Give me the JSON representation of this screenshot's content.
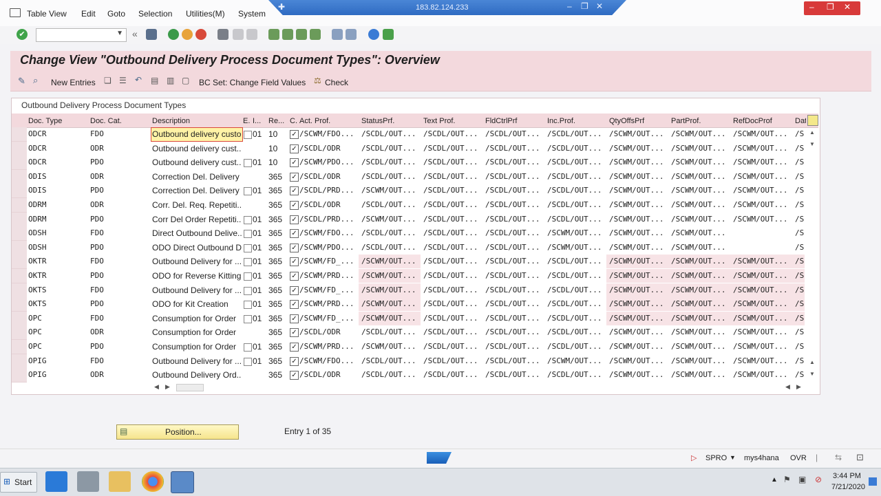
{
  "window": {
    "remote_host": "183.82.124.233"
  },
  "menu": [
    "Table View",
    "Edit",
    "Goto",
    "Selection",
    "Utilities(M)",
    "System"
  ],
  "page_title": "Change View \"Outbound Delivery Process Document Types\": Overview",
  "app_toolbar": {
    "new_entries": "New Entries",
    "bc_set": "BC Set: Change Field Values",
    "check": "Check"
  },
  "grid": {
    "title": "Outbound Delivery Process Document Types",
    "columns": [
      "Doc. Type",
      "Doc. Cat.",
      "Description",
      "E.",
      "I...",
      "Re...",
      "C.",
      "Act. Prof.",
      "StatusPrf.",
      "Text Prof.",
      "FldCtrlPrf",
      "Inc.Prof.",
      "QtyOffsPrf",
      "PartProf.",
      "RefDocProf",
      "Dat"
    ],
    "rows": [
      {
        "type": "ODCR",
        "cat": "FDO",
        "desc": "Outbound delivery custor",
        "e": true,
        "i": "01",
        "re": "10",
        "act": "/SCWM/FDO...",
        "status": "/SCDL/OUT...",
        "text": "/SCDL/OUT...",
        "fld": "/SCDL/OUT...",
        "inc": "/SCDL/OUT...",
        "qty": "/SCWM/OUT...",
        "part": "/SCWM/OUT...",
        "ref": "/SCWM/OUT...",
        "dat": "/S"
      },
      {
        "type": "ODCR",
        "cat": "ODR",
        "desc": "Outbound delivery cust...",
        "e": false,
        "i": "",
        "re": "10",
        "act": "/SCDL/ODR",
        "status": "/SCDL/OUT...",
        "text": "/SCDL/OUT...",
        "fld": "/SCDL/OUT...",
        "inc": "/SCDL/OUT...",
        "qty": "/SCWM/OUT...",
        "part": "/SCWM/OUT...",
        "ref": "/SCWM/OUT...",
        "dat": "/S"
      },
      {
        "type": "ODCR",
        "cat": "PDO",
        "desc": "Outbound delivery cust...",
        "e": true,
        "i": "01",
        "re": "10",
        "act": "/SCWM/PDO...",
        "status": "/SCDL/OUT...",
        "text": "/SCDL/OUT...",
        "fld": "/SCDL/OUT...",
        "inc": "/SCDL/OUT...",
        "qty": "/SCWM/OUT...",
        "part": "/SCWM/OUT...",
        "ref": "/SCWM/OUT...",
        "dat": "/S"
      },
      {
        "type": "ODIS",
        "cat": "ODR",
        "desc": "Correction Del. Delivery",
        "e": false,
        "i": "",
        "re": "365",
        "act": "/SCDL/ODR",
        "status": "/SCDL/OUT...",
        "text": "/SCDL/OUT...",
        "fld": "/SCDL/OUT...",
        "inc": "/SCDL/OUT...",
        "qty": "/SCWM/OUT...",
        "part": "/SCWM/OUT...",
        "ref": "/SCWM/OUT...",
        "dat": "/S"
      },
      {
        "type": "ODIS",
        "cat": "PDO",
        "desc": "Correction Del. Delivery",
        "e": true,
        "i": "01",
        "re": "365",
        "act": "/SCDL/PRD...",
        "status": "/SCWM/OUT...",
        "text": "/SCDL/OUT...",
        "fld": "/SCDL/OUT...",
        "inc": "/SCDL/OUT...",
        "qty": "/SCWM/OUT...",
        "part": "/SCWM/OUT...",
        "ref": "/SCWM/OUT...",
        "dat": "/S"
      },
      {
        "type": "ODRM",
        "cat": "ODR",
        "desc": "Corr. Del. Req. Repetiti...",
        "e": false,
        "i": "",
        "re": "365",
        "act": "/SCDL/ODR",
        "status": "/SCDL/OUT...",
        "text": "/SCDL/OUT...",
        "fld": "/SCDL/OUT...",
        "inc": "/SCDL/OUT...",
        "qty": "/SCWM/OUT...",
        "part": "/SCWM/OUT...",
        "ref": "/SCWM/OUT...",
        "dat": "/S"
      },
      {
        "type": "ODRM",
        "cat": "PDO",
        "desc": "Corr Del Order Repetiti...",
        "e": true,
        "i": "01",
        "re": "365",
        "act": "/SCDL/PRD...",
        "status": "/SCWM/OUT...",
        "text": "/SCDL/OUT...",
        "fld": "/SCDL/OUT...",
        "inc": "/SCDL/OUT...",
        "qty": "/SCWM/OUT...",
        "part": "/SCWM/OUT...",
        "ref": "/SCWM/OUT...",
        "dat": "/S"
      },
      {
        "type": "ODSH",
        "cat": "FDO",
        "desc": "Direct Outbound Delive...",
        "e": true,
        "i": "01",
        "re": "365",
        "act": "/SCWM/FDO...",
        "status": "/SCDL/OUT...",
        "text": "/SCDL/OUT...",
        "fld": "/SCDL/OUT...",
        "inc": "/SCWM/OUT...",
        "qty": "/SCWM/OUT...",
        "part": "/SCWM/OUT...",
        "ref": "",
        "dat": "/S"
      },
      {
        "type": "ODSH",
        "cat": "PDO",
        "desc": "ODO Direct Outbound D...",
        "e": true,
        "i": "01",
        "re": "365",
        "act": "/SCWM/PDO...",
        "status": "/SCDL/OUT...",
        "text": "/SCDL/OUT...",
        "fld": "/SCDL/OUT...",
        "inc": "/SCWM/OUT...",
        "qty": "/SCWM/OUT...",
        "part": "/SCWM/OUT...",
        "ref": "",
        "dat": "/S"
      },
      {
        "type": "OKTR",
        "cat": "FDO",
        "desc": "Outbound Delivery for ...",
        "e": true,
        "i": "01",
        "re": "365",
        "act": "/SCWM/FD_...",
        "status": "/SCWM/OUT...",
        "text": "/SCDL/OUT...",
        "fld": "/SCDL/OUT...",
        "inc": "/SCDL/OUT...",
        "qty": "/SCWM/OUT...",
        "part": "/SCWM/OUT...",
        "ref": "/SCWM/OUT...",
        "dat": "/S",
        "pink": true
      },
      {
        "type": "OKTR",
        "cat": "PDO",
        "desc": "ODO for Reverse Kitting",
        "e": true,
        "i": "01",
        "re": "365",
        "act": "/SCWM/PRD...",
        "status": "/SCWM/OUT...",
        "text": "/SCDL/OUT...",
        "fld": "/SCDL/OUT...",
        "inc": "/SCDL/OUT...",
        "qty": "/SCWM/OUT...",
        "part": "/SCWM/OUT...",
        "ref": "/SCWM/OUT...",
        "dat": "/S",
        "pink": true
      },
      {
        "type": "OKTS",
        "cat": "FDO",
        "desc": "Outbound Delivery for ...",
        "e": true,
        "i": "01",
        "re": "365",
        "act": "/SCWM/FD_...",
        "status": "/SCWM/OUT...",
        "text": "/SCDL/OUT...",
        "fld": "/SCDL/OUT...",
        "inc": "/SCDL/OUT...",
        "qty": "/SCWM/OUT...",
        "part": "/SCWM/OUT...",
        "ref": "/SCWM/OUT...",
        "dat": "/S",
        "pink": true
      },
      {
        "type": "OKTS",
        "cat": "PDO",
        "desc": "ODO for Kit Creation",
        "e": true,
        "i": "01",
        "re": "365",
        "act": "/SCWM/PRD...",
        "status": "/SCWM/OUT...",
        "text": "/SCDL/OUT...",
        "fld": "/SCDL/OUT...",
        "inc": "/SCDL/OUT...",
        "qty": "/SCWM/OUT...",
        "part": "/SCWM/OUT...",
        "ref": "/SCWM/OUT...",
        "dat": "/S",
        "pink": true
      },
      {
        "type": "OPC",
        "cat": "FDO",
        "desc": "Consumption for Order",
        "e": true,
        "i": "01",
        "re": "365",
        "act": "/SCWM/FD_...",
        "status": "/SCWM/OUT...",
        "text": "/SCDL/OUT...",
        "fld": "/SCDL/OUT...",
        "inc": "/SCDL/OUT...",
        "qty": "/SCWM/OUT...",
        "part": "/SCWM/OUT...",
        "ref": "/SCWM/OUT...",
        "dat": "/S",
        "pink": true
      },
      {
        "type": "OPC",
        "cat": "ODR",
        "desc": "Consumption for Order",
        "e": false,
        "i": "",
        "re": "365",
        "act": "/SCDL/ODR",
        "status": "/SCDL/OUT...",
        "text": "/SCDL/OUT...",
        "fld": "/SCDL/OUT...",
        "inc": "/SCDL/OUT...",
        "qty": "/SCWM/OUT...",
        "part": "/SCWM/OUT...",
        "ref": "/SCWM/OUT...",
        "dat": "/S"
      },
      {
        "type": "OPC",
        "cat": "PDO",
        "desc": "Consumption for Order",
        "e": true,
        "i": "01",
        "re": "365",
        "act": "/SCWM/PRD...",
        "status": "/SCWM/OUT...",
        "text": "/SCDL/OUT...",
        "fld": "/SCDL/OUT...",
        "inc": "/SCDL/OUT...",
        "qty": "/SCWM/OUT...",
        "part": "/SCWM/OUT...",
        "ref": "/SCWM/OUT...",
        "dat": "/S"
      },
      {
        "type": "OPIG",
        "cat": "FDO",
        "desc": "Outbound Delivery for ...",
        "e": true,
        "i": "01",
        "re": "365",
        "act": "/SCWM/FDO...",
        "status": "/SCDL/OUT...",
        "text": "/SCDL/OUT...",
        "fld": "/SCDL/OUT...",
        "inc": "/SCWM/OUT...",
        "qty": "/SCWM/OUT...",
        "part": "/SCWM/OUT...",
        "ref": "/SCWM/OUT...",
        "dat": "/S"
      },
      {
        "type": "OPIG",
        "cat": "ODR",
        "desc": "Outbound Delivery Ord...",
        "e": false,
        "i": "",
        "re": "365",
        "act": "/SCDL/ODR",
        "status": "/SCDL/OUT...",
        "text": "/SCDL/OUT...",
        "fld": "/SCDL/OUT...",
        "inc": "/SCDL/OUT...",
        "qty": "/SCWM/OUT...",
        "part": "/SCWM/OUT...",
        "ref": "/SCWM/OUT...",
        "dat": "/S"
      }
    ]
  },
  "footer": {
    "position_button": "Position...",
    "entry_text": "Entry 1 of 35"
  },
  "status": {
    "transaction": "SPRO",
    "system": "mys4hana",
    "mode": "OVR"
  },
  "taskbar": {
    "start": "Start",
    "time": "3:44 PM",
    "date": "7/21/2020"
  },
  "colors": {
    "accent_pink": "#f3d9dd",
    "remote_bar_blue": "#3a78cc",
    "position_yellow": "#f6e58d"
  }
}
